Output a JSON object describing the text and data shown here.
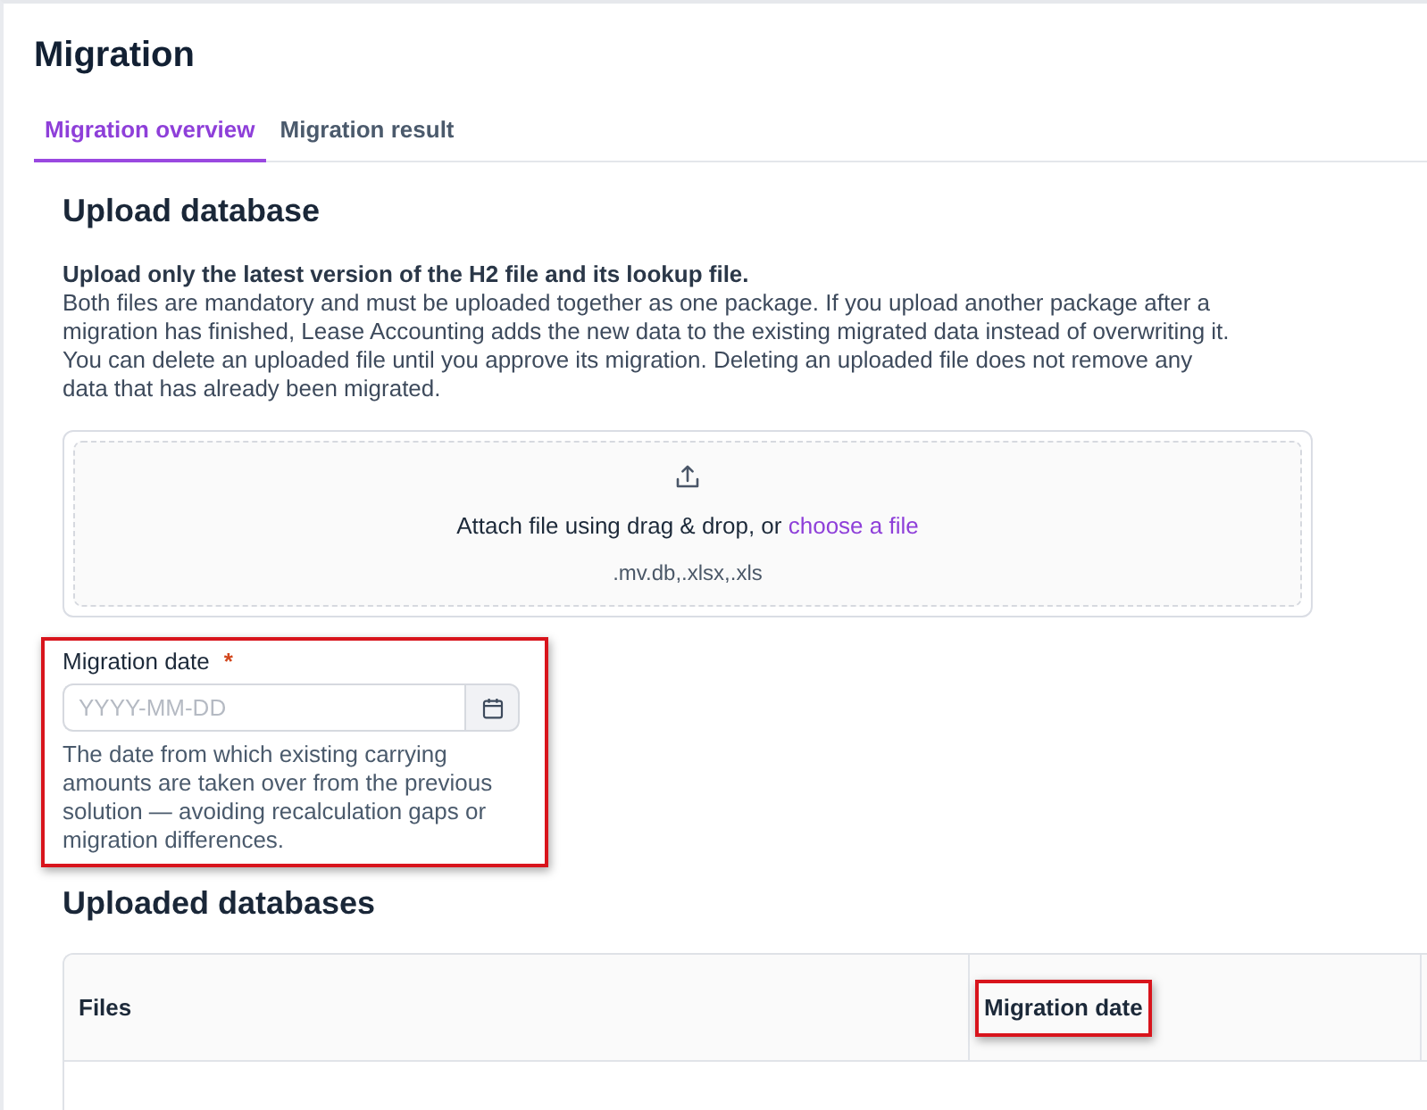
{
  "page": {
    "title": "Migration"
  },
  "tabs": [
    {
      "label": "Migration overview",
      "selected": true
    },
    {
      "label": "Migration result",
      "selected": false
    }
  ],
  "upload_database": {
    "heading": "Upload database",
    "intro_lead": "Upload only the latest version of the H2 file and its lookup file.",
    "intro_text": "Both files are mandatory and must be uploaded together as one package. If you upload another package after a migration has finished, Lease Accounting adds the new data to the existing migrated data instead of overwriting it. You can delete an uploaded file until you approve its migration. Deleting an uploaded file does not remove any data that has already been migrated.",
    "dropzone": {
      "prompt": "Attach file using drag & drop, or",
      "link": "choose a file",
      "file_types": ".mv.db,.xlsx,.xls"
    }
  },
  "migration_date": {
    "label": "Migration date",
    "required_mark": "*",
    "placeholder": "YYYY-MM-DD",
    "help": "The date from which existing carrying amounts are taken over from the previous solution — avoiding recalculation gaps or migration differences.",
    "highlighted": true
  },
  "uploaded_databases": {
    "heading": "Uploaded databases",
    "columns": [
      {
        "label": "Files",
        "highlighted": false
      },
      {
        "label": "Migration date",
        "highlighted": true
      }
    ]
  }
}
